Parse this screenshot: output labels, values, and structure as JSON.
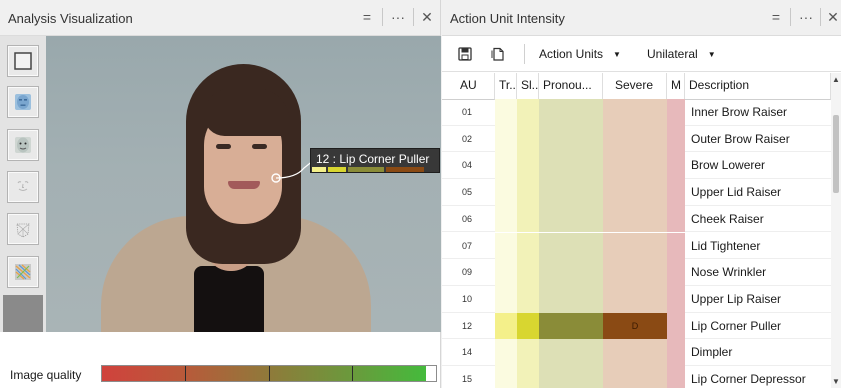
{
  "left_pane": {
    "title": "Analysis Visualization",
    "controls": [
      "=",
      "···",
      "✕"
    ],
    "tools": [
      {
        "icon": "square-outline-icon",
        "selected": true
      },
      {
        "icon": "face-mask-icon"
      },
      {
        "icon": "face-texture-icon"
      },
      {
        "icon": "face-outline-icon"
      },
      {
        "icon": "face-mesh-icon"
      },
      {
        "icon": "heatmap-icon"
      }
    ],
    "callout": {
      "text": "12 : Lip Corner Puller",
      "bars": [
        "#f4f08a",
        "#d8d630",
        "#8a8c38",
        "#8a4a14"
      ]
    },
    "image_quality": {
      "label": "Image quality",
      "value": 0.97
    }
  },
  "right_pane": {
    "title": "Action Unit Intensity",
    "controls": [
      "=",
      "···",
      "✕"
    ],
    "toolbar": {
      "save_icon": "save-icon",
      "copy_icon": "copy-icon",
      "dropdown1": "Action Units",
      "dropdown2": "Unilateral"
    },
    "table": {
      "headers": [
        "AU",
        "Tr...",
        "Sl...",
        "Pronou...",
        "Severe",
        "M",
        "Description"
      ],
      "column_colors": {
        "trace": "#fbfbe0",
        "slight": "#f2f2b8",
        "pronounced": "#dde0b6",
        "severe": "#e7cdb9",
        "max": "#e7b9bb"
      },
      "highlight_colors": {
        "trace": "#f4f08a",
        "slight": "#d8d630",
        "pronounced": "#8a8c38",
        "severe": "#8a4a14"
      },
      "rows": [
        {
          "au": "01",
          "description": "Inner Brow Raiser"
        },
        {
          "au": "02",
          "description": "Outer Brow Raiser"
        },
        {
          "au": "04",
          "description": "Brow Lowerer"
        },
        {
          "au": "05",
          "description": "Upper Lid Raiser"
        },
        {
          "au": "06",
          "description": "Cheek Raiser"
        },
        {
          "au": "07",
          "description": "Lid Tightener"
        },
        {
          "au": "09",
          "description": "Nose Wrinkler"
        },
        {
          "au": "10",
          "description": "Upper Lip Raiser"
        },
        {
          "au": "12",
          "description": "Lip Corner Puller",
          "active": true,
          "severe_label": "D"
        },
        {
          "au": "14",
          "description": "Dimpler"
        },
        {
          "au": "15",
          "description": "Lip Corner Depressor"
        }
      ]
    },
    "scrollbar": {
      "up": "▲",
      "down": "▼"
    }
  }
}
